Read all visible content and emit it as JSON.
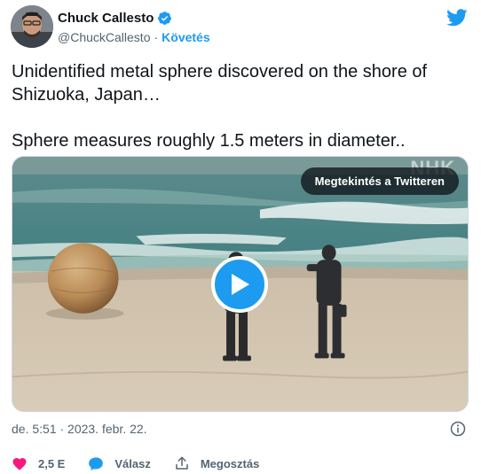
{
  "author": {
    "name": "Chuck Callesto",
    "handle": "@ChuckCallesto",
    "separator": "·",
    "follow_label": "Követés"
  },
  "tweet": {
    "text": "Unidentified metal sphere discovered on the shore of\nShizuoka, Japan…\n\nSphere measures roughly 1.5 meters in diameter.."
  },
  "media": {
    "watch_label": "Megtekintés a Twitteren",
    "watermark": "NHK"
  },
  "meta": {
    "timestamp": "de. 5:51 · 2023. febr. 22."
  },
  "actions": {
    "likes_count": "2,5 E",
    "reply_label": "Válasz",
    "share_label": "Megosztás"
  },
  "colors": {
    "accent": "#1d9bf0",
    "like": "#f91880",
    "muted": "#536471"
  },
  "icons": {
    "verified": "verified-badge-icon",
    "logo": "twitter-bird-icon",
    "play": "play-icon",
    "info": "info-icon",
    "like": "heart-icon",
    "reply": "reply-bubble-icon",
    "share": "share-upload-icon"
  }
}
